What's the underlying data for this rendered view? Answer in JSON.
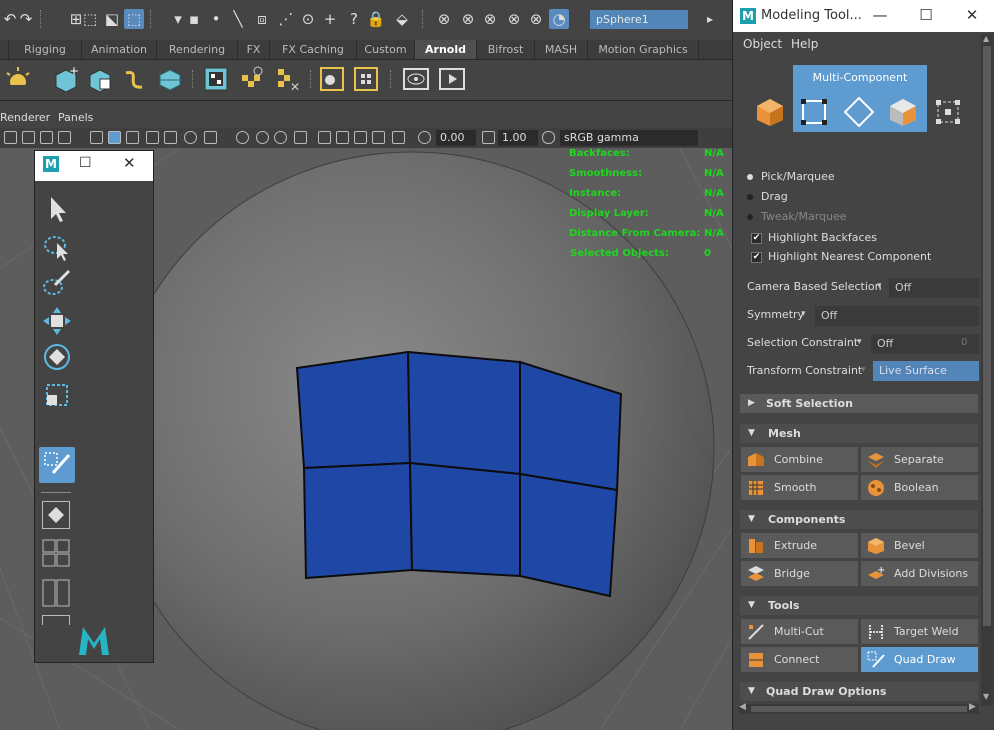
{
  "toolbar": {
    "object_field": "pSphere1"
  },
  "shelf_tabs": [
    "Rigging",
    "Animation",
    "Rendering",
    "FX",
    "FX Caching",
    "Custom",
    "Arnold",
    "Bifrost",
    "MASH",
    "Motion Graphics"
  ],
  "shelf_active": "Arnold",
  "panel_menu": {
    "renderer": "Renderer",
    "panels": "Panels"
  },
  "panel_toolbar": {
    "exposure": "0.00",
    "gamma": "1.00",
    "color_space": "sRGB gamma"
  },
  "hud": [
    {
      "label": "Backfaces:",
      "value": "N/A"
    },
    {
      "label": "Smoothness:",
      "value": "N/A"
    },
    {
      "label": "Instance:",
      "value": "N/A"
    },
    {
      "label": "Display Layer:",
      "value": "N/A"
    },
    {
      "label": "Distance From Camera:",
      "value": "N/A"
    },
    {
      "label": "Selected Objects:",
      "value": "0"
    }
  ],
  "toolbox": {
    "logo": "M"
  },
  "modeling_toolkit": {
    "title": "Modeling Tool...",
    "menu": [
      "Object",
      "Help"
    ],
    "mode_label": "Multi-Component",
    "selection_modes": [
      "Pick/Marquee",
      "Drag",
      "Tweak/Marquee"
    ],
    "checks": [
      "Highlight Backfaces",
      "Highlight Nearest Component"
    ],
    "options": [
      {
        "label": "Camera Based Selection",
        "value": "Off"
      },
      {
        "label": "Symmetry",
        "value": "Off"
      },
      {
        "label": "Selection Constraint",
        "value": "Off",
        "extra": "0"
      },
      {
        "label": "Transform Constraint",
        "value": "Live Surface"
      }
    ],
    "sections": {
      "soft_selection": "Soft Selection",
      "mesh": "Mesh",
      "components": "Components",
      "tools": "Tools",
      "quad_draw_options": "Quad Draw Options"
    },
    "mesh_buttons": [
      "Combine",
      "Separate",
      "Smooth",
      "Boolean"
    ],
    "component_buttons": [
      "Extrude",
      "Bevel",
      "Bridge",
      "Add Divisions"
    ],
    "tool_buttons": [
      "Multi-Cut",
      "Target Weld",
      "Connect",
      "Quad Draw"
    ]
  },
  "colors": {
    "accent": "#5e9bd0",
    "face_blue": "#1f48a6",
    "hud_green": "#1fd61f"
  }
}
